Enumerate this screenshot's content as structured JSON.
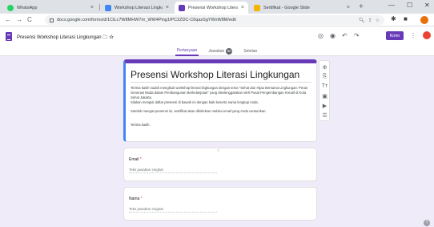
{
  "browser": {
    "tabs": [
      {
        "title": "WhatsApp",
        "color": "#25d366",
        "active": false
      },
      {
        "title": "Workshop Literasi Lingkungan - ",
        "color": "#4285f4",
        "active": false
      },
      {
        "title": "Presensi Workshop Literasi Lingk",
        "color": "#673ab7",
        "active": true
      },
      {
        "title": "Sertifikat - Google Slide",
        "color": "#f4b400",
        "active": false
      }
    ],
    "url": "docs.google.com/forms/d/1CtLc7W8MHW7rir_WW4Ping1IPC2ZDC-C6qasSgYWxW8M/edit",
    "nav": {
      "back": "←",
      "forward": "→",
      "reload": "C"
    }
  },
  "app": {
    "form_name": "Presensi Workshop Literasi Lingkungan",
    "send_label": "Kirim",
    "tabs": [
      {
        "label": "Pertanyaan",
        "active": true
      },
      {
        "label": "Jawaban",
        "active": false,
        "badge": "60"
      },
      {
        "label": "Setelan",
        "active": false
      }
    ]
  },
  "form": {
    "title": "Presensi Workshop Literasi Lingkungan",
    "description": [
      "Terima kasih sudah mengikuti workshop literasi lingkungan dengan tema \"Sehat dan Hijau Bersama Lingkungan: Peran Generasi Muda dalam Pembangunan Berkelanjutan\" yang diselenggarakan oleh Pusat Pengembangan Kreatif di Kota Sehat Jakarta.",
      "Silakan mengisi daftar presensi di bawah ini dengan baik beserta nama lengkap Anda.",
      "Setelah mengisi presensi ini, sertifikat akan dikirimkan melalui email yang Anda cantumkan.",
      "Terima kasih."
    ],
    "questions": [
      {
        "label": "Email",
        "required": "*",
        "placeholder": "Teks jawaban singkat"
      },
      {
        "label": "Nama",
        "required": "*",
        "placeholder": "Teks jawaban singkat"
      }
    ]
  },
  "colors": {
    "accent": "#673ab7",
    "background": "#f0ebf8"
  }
}
